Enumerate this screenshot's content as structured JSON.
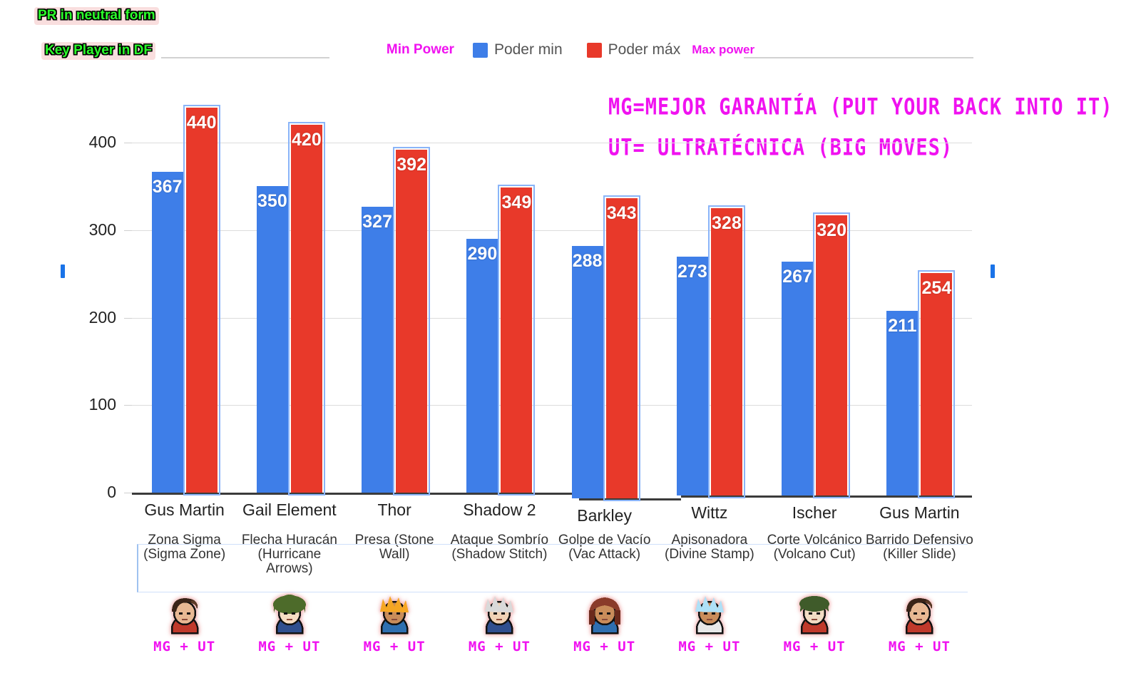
{
  "annotations": {
    "pr_neutral": "PR in neutral form",
    "key_player_df": "Key Player in DF",
    "mg_note": "MG=MEJOR GARANTÍA (PUT YOUR BACK INTO IT)",
    "ut_note": "UT= ULTRATÉCNICA (BIG MOVES)"
  },
  "legend": {
    "min_power_note": "Min Power",
    "max_power_note": "Max power",
    "series": [
      {
        "label": "Poder min",
        "color": "#3e7ee8"
      },
      {
        "label": "Poder máx",
        "color": "#e8392a"
      }
    ]
  },
  "chart_data": {
    "type": "bar",
    "title": "",
    "xlabel": "",
    "ylabel": "",
    "ylim": [
      0,
      450
    ],
    "yticks": [
      0,
      100,
      200,
      300,
      400
    ],
    "grid": true,
    "legend_position": "top-center",
    "categories": [
      "Gus Martin",
      "Gail Element",
      "Thor",
      "Shadow 2",
      "Barkley",
      "Wittz",
      "Ischer",
      "Gus Martin"
    ],
    "series": [
      {
        "name": "Poder min",
        "color": "#3e7ee8",
        "values": [
          367,
          350,
          327,
          290,
          288,
          273,
          267,
          211
        ]
      },
      {
        "name": "Poder máx",
        "color": "#e8392a",
        "values": [
          440,
          420,
          392,
          349,
          343,
          328,
          320,
          254
        ]
      }
    ],
    "annotations": {
      "moves": [
        "Zona Sigma (Sigma Zone)",
        "Flecha Huracán (Hurricane Arrows)",
        "Presa (Stone Wall)",
        "Ataque Sombrío (Shadow Stitch)",
        "Golpe de Vacío (Vac Attack)",
        "Apisonadora (Divine Stamp)",
        "Corte Volcánico (Volcano Cut)",
        "Barrido Defensivo (Killer Slide)"
      ],
      "tags": [
        "MG + UT",
        "MG + UT",
        "MG + UT",
        "MG + UT",
        "MG + UT",
        "MG + UT",
        "MG + UT",
        "MG + UT"
      ]
    }
  },
  "characters": [
    {
      "name": "Gus Martin",
      "hair": "#3a2418",
      "hair2": "#5c3a26",
      "skin": "#e8b893",
      "shirt": "#c0392b",
      "coat": "#4a4a4a",
      "style": "slick"
    },
    {
      "name": "Gail Element",
      "hair": "#4d6b2a",
      "hair2": "#3e5722",
      "skin": "#f7ddc3",
      "shirt": "#2f4f8f",
      "coat": "#2f4f8f",
      "style": "bushy"
    },
    {
      "name": "Thor",
      "hair": "#f5a623",
      "hair2": "#d98c10",
      "skin": "#c98c5a",
      "shirt": "#2f6fb0",
      "coat": "#2f6fb0",
      "style": "spike"
    },
    {
      "name": "Shadow 2",
      "hair": "#d9d9d9",
      "hair2": "#b3b3b3",
      "skin": "#f0d2b6",
      "shirt": "#2f4f8f",
      "coat": "#2f4f8f",
      "style": "spike"
    },
    {
      "name": "Barkley",
      "hair": "#8a3b2a",
      "hair2": "#6b2a1c",
      "skin": "#c98c5a",
      "shirt": "#2f6fb0",
      "coat": "#2f6fb0",
      "style": "long"
    },
    {
      "name": "Wittz",
      "hair": "#aee0f7",
      "hair2": "#7fc7ec",
      "skin": "#c98c5a",
      "shirt": "#e8e8e8",
      "coat": "#3a3a3a",
      "style": "spike"
    },
    {
      "name": "Ischer",
      "hair": "#3f5b2a",
      "hair2": "#2d421d",
      "skin": "#f2dcc4",
      "shirt": "#c0392b",
      "coat": "#c0392b",
      "style": "bowl"
    },
    {
      "name": "Gus Martin",
      "hair": "#3a2418",
      "hair2": "#5c3a26",
      "skin": "#e8b893",
      "shirt": "#c0392b",
      "coat": "#4a4a4a",
      "style": "slick"
    }
  ]
}
